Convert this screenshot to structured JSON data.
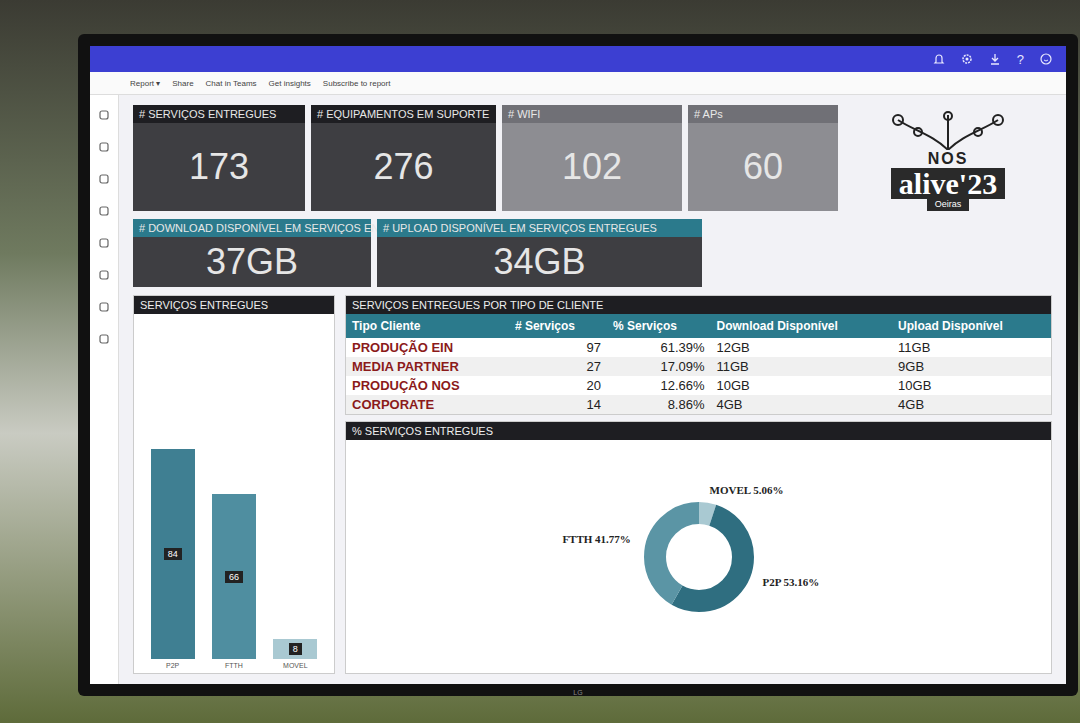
{
  "topbar": {
    "help": "?"
  },
  "toolbar": [
    "Report ▾",
    "Share",
    "Chat in Teams",
    "Get insights",
    "Subscribe to report"
  ],
  "kpis_top": [
    {
      "label": "# SERVIÇOS ENTREGUES",
      "value": "173",
      "kind": "dark"
    },
    {
      "label": "# EQUIPAMENTOS EM SUPORTE",
      "value": "276",
      "kind": "dark"
    },
    {
      "label": "# WIFI",
      "value": "102",
      "kind": "light"
    },
    {
      "label": "# APs",
      "value": "60",
      "kind": "light"
    }
  ],
  "kpis_bottom": [
    {
      "label": "# DOWNLOAD DISPONÍVEL EM SERVIÇOS ENTREGUES",
      "value": "37GB",
      "kind": "accent"
    },
    {
      "label": "# UPLOAD DISPONÍVEL EM SERVIÇOS ENTREGUES",
      "value": "34GB",
      "kind": "accent"
    }
  ],
  "logo": {
    "brand": "NOS",
    "name": "alive'23",
    "place": "Oeiras"
  },
  "bar_chart": {
    "title": "SERVIÇOS ENTREGUES",
    "bars": [
      {
        "category": "P2P",
        "value": 84,
        "label": "84",
        "color": "#3f7f92"
      },
      {
        "category": "FTTH",
        "value": 66,
        "label": "66",
        "color": "#4f8ea0"
      },
      {
        "category": "MOVEL",
        "value": 8,
        "label": "8",
        "color": "#a9c9d2"
      }
    ]
  },
  "table": {
    "title": "SERVIÇOS ENTREGUES POR TIPO DE CLIENTE",
    "columns": [
      "Tipo Cliente",
      "# Serviços",
      "% Serviços",
      "Download Disponível",
      "Upload Disponível"
    ],
    "rows": [
      [
        "PRODUÇÃO EIN",
        "97",
        "61.39%",
        "12GB",
        "11GB"
      ],
      [
        "MEDIA PARTNER",
        "27",
        "17.09%",
        "11GB",
        "9GB"
      ],
      [
        "PRODUÇÃO NOS",
        "20",
        "12.66%",
        "10GB",
        "10GB"
      ],
      [
        "CORPORATE",
        "14",
        "8.86%",
        "4GB",
        "4GB"
      ]
    ]
  },
  "donut": {
    "title": "% SERVIÇOS ENTREGUES",
    "slices": [
      {
        "label": "MOVEL 5.06%",
        "value": 5.06,
        "color": "#a9c9d2"
      },
      {
        "label": "P2P 53.16%",
        "value": 53.16,
        "color": "#2f6e80"
      },
      {
        "label": "FTTH 41.77%",
        "value": 41.77,
        "color": "#5b95a5"
      }
    ]
  },
  "monitor": {
    "brand": "LG"
  }
}
